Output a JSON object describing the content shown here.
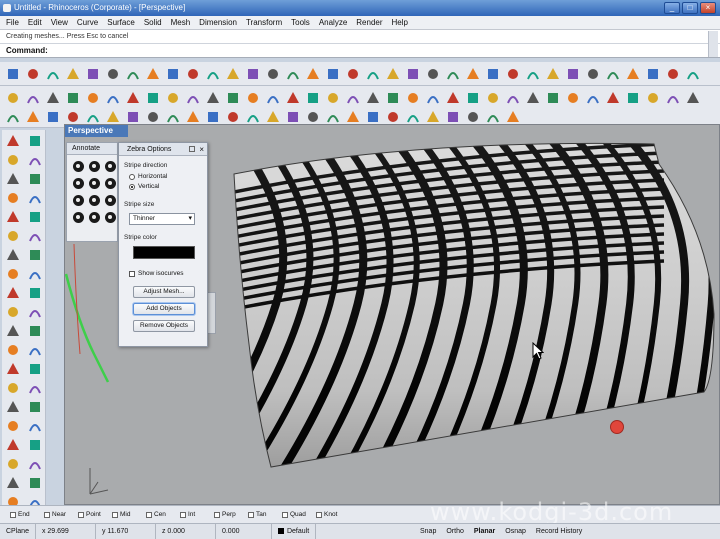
{
  "window": {
    "title": "Untitled - Rhinoceros (Corporate) - [Perspective]",
    "controls": [
      "_",
      "□",
      "×"
    ]
  },
  "menu": [
    "File",
    "Edit",
    "View",
    "Curve",
    "Surface",
    "Solid",
    "Mesh",
    "Dimension",
    "Transform",
    "Tools",
    "Analyze",
    "Render",
    "Help"
  ],
  "history": "Creating meshes... Press Esc to cancel",
  "command": {
    "label": "Command:",
    "value": ""
  },
  "viewport": {
    "title": "Perspective"
  },
  "annotate_panel": {
    "title": "Annotate"
  },
  "zebra": {
    "title": "Zebra Options",
    "direction_label": "Stripe direction",
    "horizontal_label": "Horizontal",
    "vertical_label": "Vertical",
    "size_label": "Stripe size",
    "size_value": "Thinner",
    "color_label": "Stripe color",
    "stripe_color": "#000000",
    "show_isocurves_label": "Show isocurves",
    "adjust_mesh_label": "Adjust Mesh...",
    "add_objects_label": "Add Objects",
    "remove_objects_label": "Remove Objects"
  },
  "osnaps": [
    "End",
    "Near",
    "Point",
    "Mid",
    "Cen",
    "Int",
    "Perp",
    "Tan",
    "Quad",
    "Knot"
  ],
  "status": {
    "cplane": "CPlane",
    "x": "x 29.699",
    "y": "y 11.670",
    "z": "z 0.000",
    "d": "0.000",
    "layer": "Default",
    "modes": [
      "Snap",
      "Ortho",
      "Planar",
      "Osnap",
      "Record History"
    ]
  },
  "watermark": "www.kodgi-3d.com",
  "colors": {
    "title_bar": "#2f65b8",
    "viewport_bg": "#a9abad",
    "accent": "#4a78b8"
  }
}
